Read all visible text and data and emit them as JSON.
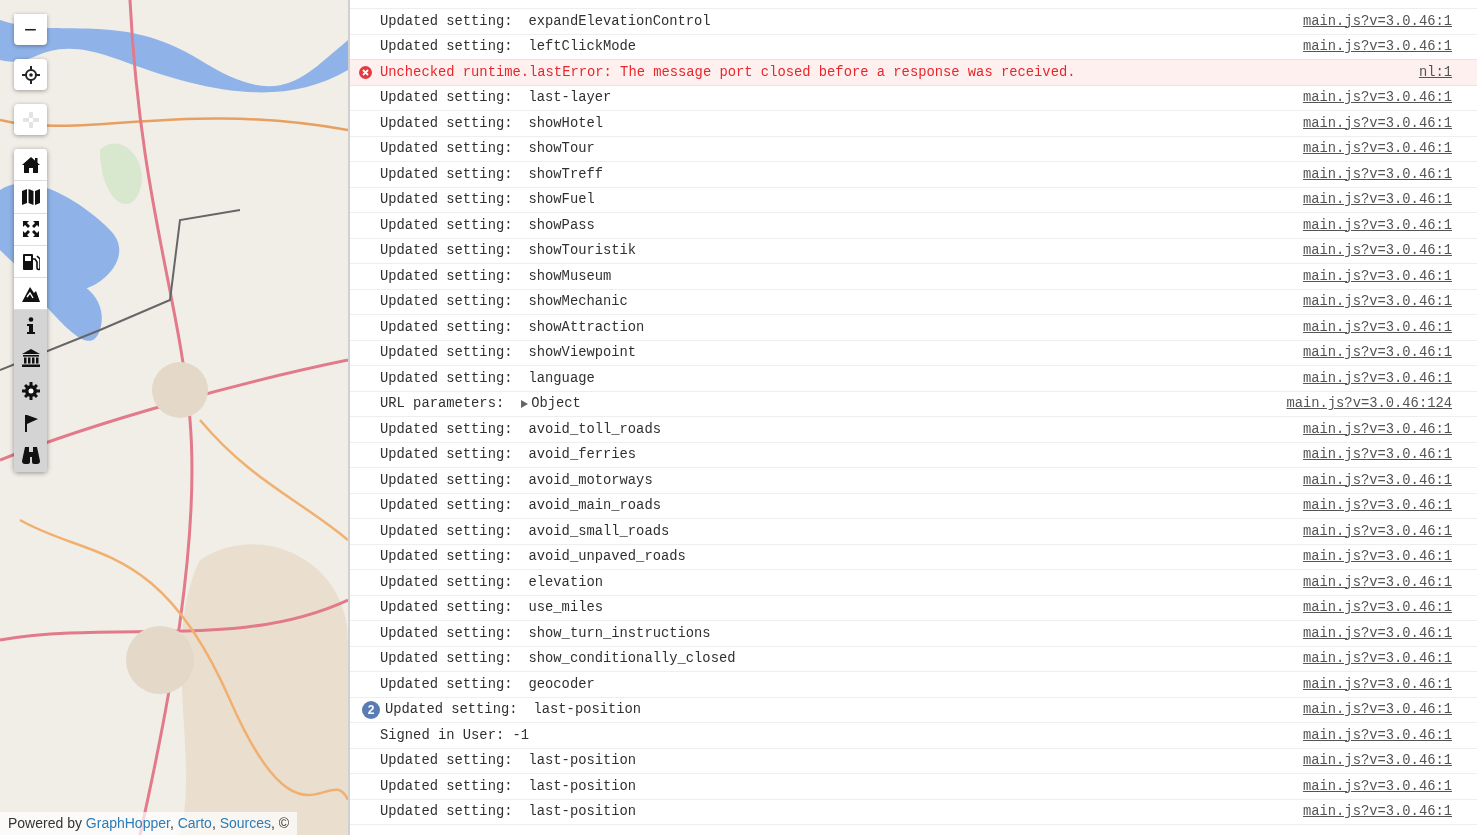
{
  "map": {
    "zoom_out": "−",
    "tools": [
      {
        "kind": "locate",
        "disabled": false
      },
      {
        "kind": "crosshair",
        "disabled": true
      }
    ],
    "toolbar": [
      {
        "kind": "home",
        "active": false
      },
      {
        "kind": "map",
        "active": false
      },
      {
        "kind": "expand",
        "active": false
      },
      {
        "kind": "fuel",
        "active": false
      },
      {
        "kind": "mountain",
        "active": false
      },
      {
        "kind": "info",
        "active": true
      },
      {
        "kind": "museum",
        "active": true
      },
      {
        "kind": "gear",
        "active": true
      },
      {
        "kind": "flag",
        "active": true
      },
      {
        "kind": "binoculars",
        "active": true
      }
    ],
    "attribution": {
      "prefix": "Powered by",
      "links": [
        {
          "text": "GraphHopper",
          "after": ","
        },
        {
          "text": "Carto",
          "after": ","
        },
        {
          "text": "Sources",
          "after": ","
        }
      ],
      "suffix": "©"
    }
  },
  "console": {
    "rows": [
      {
        "kind": "log",
        "label": "Updated setting:",
        "value": "expandElevationControl",
        "source": "main.js?v=3.0.46:1"
      },
      {
        "kind": "log",
        "label": "Updated setting:",
        "value": "leftClickMode",
        "source": "main.js?v=3.0.46:1"
      },
      {
        "kind": "error",
        "label": "Unchecked runtime.lastError: The message port closed before a response was received.",
        "source": "nl:1"
      },
      {
        "kind": "log",
        "label": "Updated setting:",
        "value": "last-layer",
        "source": "main.js?v=3.0.46:1"
      },
      {
        "kind": "log",
        "label": "Updated setting:",
        "value": "showHotel",
        "source": "main.js?v=3.0.46:1"
      },
      {
        "kind": "log",
        "label": "Updated setting:",
        "value": "showTour",
        "source": "main.js?v=3.0.46:1"
      },
      {
        "kind": "log",
        "label": "Updated setting:",
        "value": "showTreff",
        "source": "main.js?v=3.0.46:1"
      },
      {
        "kind": "log",
        "label": "Updated setting:",
        "value": "showFuel",
        "source": "main.js?v=3.0.46:1"
      },
      {
        "kind": "log",
        "label": "Updated setting:",
        "value": "showPass",
        "source": "main.js?v=3.0.46:1"
      },
      {
        "kind": "log",
        "label": "Updated setting:",
        "value": "showTouristik",
        "source": "main.js?v=3.0.46:1"
      },
      {
        "kind": "log",
        "label": "Updated setting:",
        "value": "showMuseum",
        "source": "main.js?v=3.0.46:1"
      },
      {
        "kind": "log",
        "label": "Updated setting:",
        "value": "showMechanic",
        "source": "main.js?v=3.0.46:1"
      },
      {
        "kind": "log",
        "label": "Updated setting:",
        "value": "showAttraction",
        "source": "main.js?v=3.0.46:1"
      },
      {
        "kind": "log",
        "label": "Updated setting:",
        "value": "showViewpoint",
        "source": "main.js?v=3.0.46:1"
      },
      {
        "kind": "log",
        "label": "Updated setting:",
        "value": "language",
        "source": "main.js?v=3.0.46:1"
      },
      {
        "kind": "object",
        "label": "URL parameters:",
        "value": "Object",
        "expanded": false,
        "source": "main.js?v=3.0.46:124"
      },
      {
        "kind": "log",
        "label": "Updated setting:",
        "value": "avoid_toll_roads",
        "source": "main.js?v=3.0.46:1"
      },
      {
        "kind": "log",
        "label": "Updated setting:",
        "value": "avoid_ferries",
        "source": "main.js?v=3.0.46:1"
      },
      {
        "kind": "log",
        "label": "Updated setting:",
        "value": "avoid_motorways",
        "source": "main.js?v=3.0.46:1"
      },
      {
        "kind": "log",
        "label": "Updated setting:",
        "value": "avoid_main_roads",
        "source": "main.js?v=3.0.46:1"
      },
      {
        "kind": "log",
        "label": "Updated setting:",
        "value": "avoid_small_roads",
        "source": "main.js?v=3.0.46:1"
      },
      {
        "kind": "log",
        "label": "Updated setting:",
        "value": "avoid_unpaved_roads",
        "source": "main.js?v=3.0.46:1"
      },
      {
        "kind": "log",
        "label": "Updated setting:",
        "value": "elevation",
        "source": "main.js?v=3.0.46:1"
      },
      {
        "kind": "log",
        "label": "Updated setting:",
        "value": "use_miles",
        "source": "main.js?v=3.0.46:1"
      },
      {
        "kind": "log",
        "label": "Updated setting:",
        "value": "show_turn_instructions",
        "source": "main.js?v=3.0.46:1"
      },
      {
        "kind": "log",
        "label": "Updated setting:",
        "value": "show_conditionally_closed",
        "source": "main.js?v=3.0.46:1"
      },
      {
        "kind": "log",
        "label": "Updated setting:",
        "value": "geocoder",
        "source": "main.js?v=3.0.46:1"
      },
      {
        "kind": "log",
        "count": "2",
        "label": "Updated setting:",
        "value": "last-position",
        "source": "main.js?v=3.0.46:1"
      },
      {
        "kind": "log",
        "label": "Signed in User: -1",
        "source": "main.js?v=3.0.46:1"
      },
      {
        "kind": "log",
        "label": "Updated setting:",
        "value": "last-position",
        "source": "main.js?v=3.0.46:1"
      },
      {
        "kind": "log",
        "label": "Updated setting:",
        "value": "last-position",
        "source": "main.js?v=3.0.46:1"
      },
      {
        "kind": "log",
        "label": "Updated setting:",
        "value": "last-position",
        "source": "main.js?v=3.0.46:1"
      }
    ]
  }
}
